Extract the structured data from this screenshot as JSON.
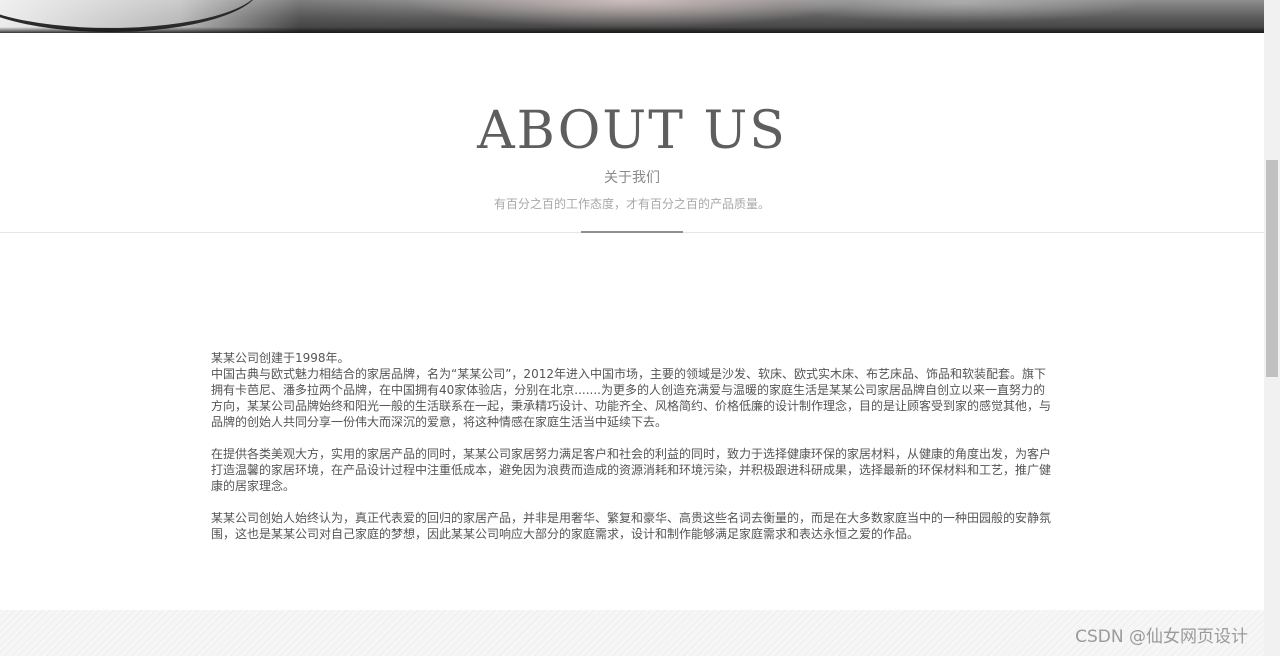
{
  "hero": {
    "image_name": "hero-banner-image"
  },
  "about": {
    "title": "ABOUT US",
    "subtitle": "关于我们",
    "tagline": "有百分之百的工作态度，才有百分之百的产品质量。"
  },
  "content": {
    "paragraphs": [
      "某某公司创建于1998年。",
      "中国古典与欧式魅力相结合的家居品牌，名为“某某公司”，2012年进入中国市场，主要的领域是沙发、软床、欧式实木床、布艺床品、饰品和软装配套。旗下拥有卡芭尼、潘多拉两个品牌，在中国拥有40家体验店，分别在北京.......为更多的人创造充满爱与温暖的家庭生活是某某公司家居品牌自创立以来一直努力的方向，某某公司品牌始终和阳光一般的生活联系在一起，秉承精巧设计、功能齐全、风格简约、价格低廉的设计制作理念，目的是让顾客受到家的感觉其他，与品牌的创始人共同分享一份伟大而深沉的爱意，将这种情感在家庭生活当中延续下去。",
      "在提供各类美观大方，实用的家居产品的同时，某某公司家居努力满足客户和社会的利益的同时，致力于选择健康环保的家居材料，从健康的角度出发，为客户打造温馨的家居环境，在产品设计过程中注重低成本，避免因为浪费而造成的资源消耗和环境污染，并积极跟进科研成果，选择最新的环保材料和工艺，推广健康的居家理念。",
      "某某公司创始人始终认为，真正代表爱的回归的家居产品，并非是用奢华、繁复和豪华、高贵这些名词去衡量的，而是在大多数家庭当中的一种田园般的安静氛围，这也是某某公司对自己家庭的梦想，因此某某公司响应大部分的家庭需求，设计和制作能够满足家庭需求和表达永恒之爱的作品。"
    ]
  },
  "watermark": {
    "text": "CSDN @仙女网页设计"
  },
  "colors": {
    "title": "#5e5e5e",
    "subtitle": "#8a8a8a",
    "tagline": "#a8a8a8",
    "body_text": "#555555",
    "divider_accent": "#8f8f8f"
  }
}
